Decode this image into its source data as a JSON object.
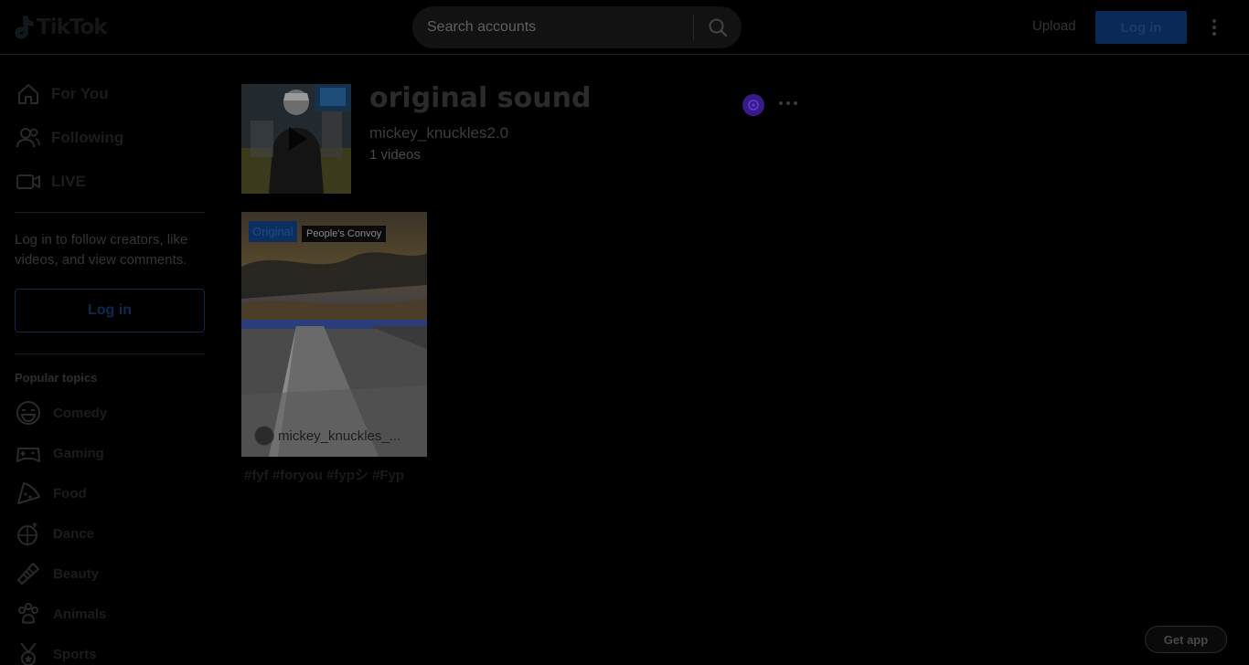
{
  "header": {
    "logo_text": "TikTok",
    "search_placeholder": "Search accounts",
    "upload_label": "Upload",
    "login_label": "Log in"
  },
  "sidebar": {
    "nav": [
      {
        "label": "For You",
        "icon": "home-icon"
      },
      {
        "label": "Following",
        "icon": "users-icon"
      },
      {
        "label": "LIVE",
        "icon": "live-icon"
      }
    ],
    "login_prompt": "Log in to follow creators, like videos, and view comments.",
    "login_label": "Log in",
    "popular_title": "Popular topics",
    "topics": [
      {
        "label": "Comedy",
        "icon": "comedy-icon"
      },
      {
        "label": "Gaming",
        "icon": "gaming-icon"
      },
      {
        "label": "Food",
        "icon": "food-icon"
      },
      {
        "label": "Dance",
        "icon": "dance-icon"
      },
      {
        "label": "Beauty",
        "icon": "beauty-icon"
      },
      {
        "label": "Animals",
        "icon": "animals-icon"
      },
      {
        "label": "Sports",
        "icon": "sports-icon"
      }
    ]
  },
  "sound": {
    "title": "original sound",
    "author": "mickey_knuckles2.0",
    "video_count": "1 videos"
  },
  "video": {
    "badge": "Original",
    "overlay_text": "People's Convoy",
    "username": "mickey_knuckles_...",
    "caption": "#fyf #foryou #fypシ #Fyp"
  },
  "get_app_label": "Get app",
  "colors": {
    "background": "#000000",
    "accent_blue": "#0a2a55",
    "share_purple": "#3a1a8a"
  }
}
